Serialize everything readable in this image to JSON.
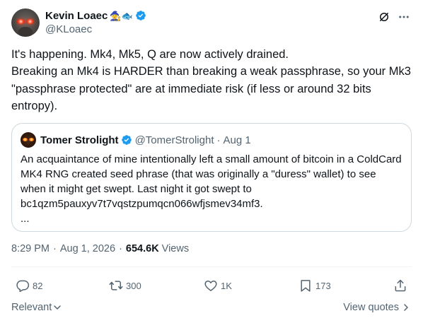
{
  "author": {
    "name": "Kevin Loaec",
    "name_emoji": "🧙🐟",
    "handle": "@KLoaec"
  },
  "tweet": {
    "text": "It's happening. Mk4, Mk5, Q are now actively drained.\nBreaking an Mk4 is HARDER than breaking a weak passphrase, so your Mk3 \"passphrase protected\" are at immediate risk (if less or around 32 bits entropy)."
  },
  "quote": {
    "name": "Tomer Strolight",
    "handle": "@TomerStrolight",
    "separator": "·",
    "date": "Aug 1",
    "text": "An acquaintance of mine intentionally left a small amount of bitcoin in a ColdCard MK4 RNG created seed phrase (that was originally a \"duress\" wallet) to see when it might get swept. Last night it got swept to bc1qzm5pauxyv7t7vqstzpumqcn066wfjsmev34mf3.\n..."
  },
  "meta": {
    "time": "8:29 PM",
    "dot1": "·",
    "date": "Aug 1, 2026",
    "dot2": "·",
    "views_count": "654.6K",
    "views_label": "Views"
  },
  "actions": {
    "replies": "82",
    "reposts": "300",
    "likes": "1K",
    "bookmarks": "173"
  },
  "bottom": {
    "sort_label": "Relevant",
    "view_quotes_label": "View quotes"
  },
  "colors": {
    "verified": "#1d9bf0",
    "secondary_text": "#536471",
    "primary_text": "#0f1419",
    "border": "#cfd9de"
  },
  "icons": [
    "verified-badge-icon",
    "grok-icon",
    "more-icon",
    "reply-icon",
    "repost-icon",
    "like-icon",
    "bookmark-icon",
    "share-icon",
    "chevron-down-icon",
    "chevron-right-icon"
  ]
}
